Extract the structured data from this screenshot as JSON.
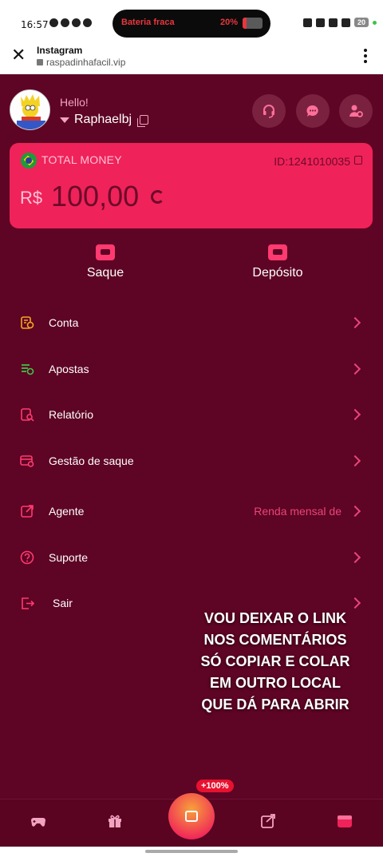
{
  "status_bar": {
    "time": "16:57",
    "battery_warning": "Bateria fraca",
    "battery_percent": "20%",
    "battery_level": 0.2,
    "battery_badge": "20"
  },
  "browser": {
    "title": "Instagram",
    "url": "raspadinhafacil.vip"
  },
  "profile": {
    "greeting": "Hello!",
    "username": "Raphaelbj"
  },
  "wallet": {
    "label": "TOTAL MONEY",
    "id": "ID:1241010035",
    "currency": "R$",
    "amount": "100,00"
  },
  "actions": [
    {
      "label": "Saque"
    },
    {
      "label": "Depósito"
    }
  ],
  "menu": [
    {
      "label": "Conta",
      "icon": "account-icon"
    },
    {
      "label": "Apostas",
      "icon": "bets-icon"
    },
    {
      "label": "Relatório",
      "icon": "report-icon"
    },
    {
      "label": "Gestão de saque",
      "icon": "withdraw-management-icon"
    },
    {
      "label": "Agente",
      "icon": "agent-icon",
      "extra": "Renda mensal de"
    },
    {
      "label": "Suporte",
      "icon": "support-icon"
    },
    {
      "label": "Sair",
      "icon": "logout-icon"
    }
  ],
  "overlay_text": [
    "VOU DEIXAR O LINK",
    "NOS COMENTÁRIOS",
    "SÓ COPIAR E COLAR",
    "EM OUTRO LOCAL",
    "QUE DÁ PARA ABRIR"
  ],
  "bottom_nav": {
    "bonus_badge": "+100%"
  },
  "colors": {
    "background": "#5e0424",
    "card": "#f0225a",
    "accent": "#e9457a"
  }
}
